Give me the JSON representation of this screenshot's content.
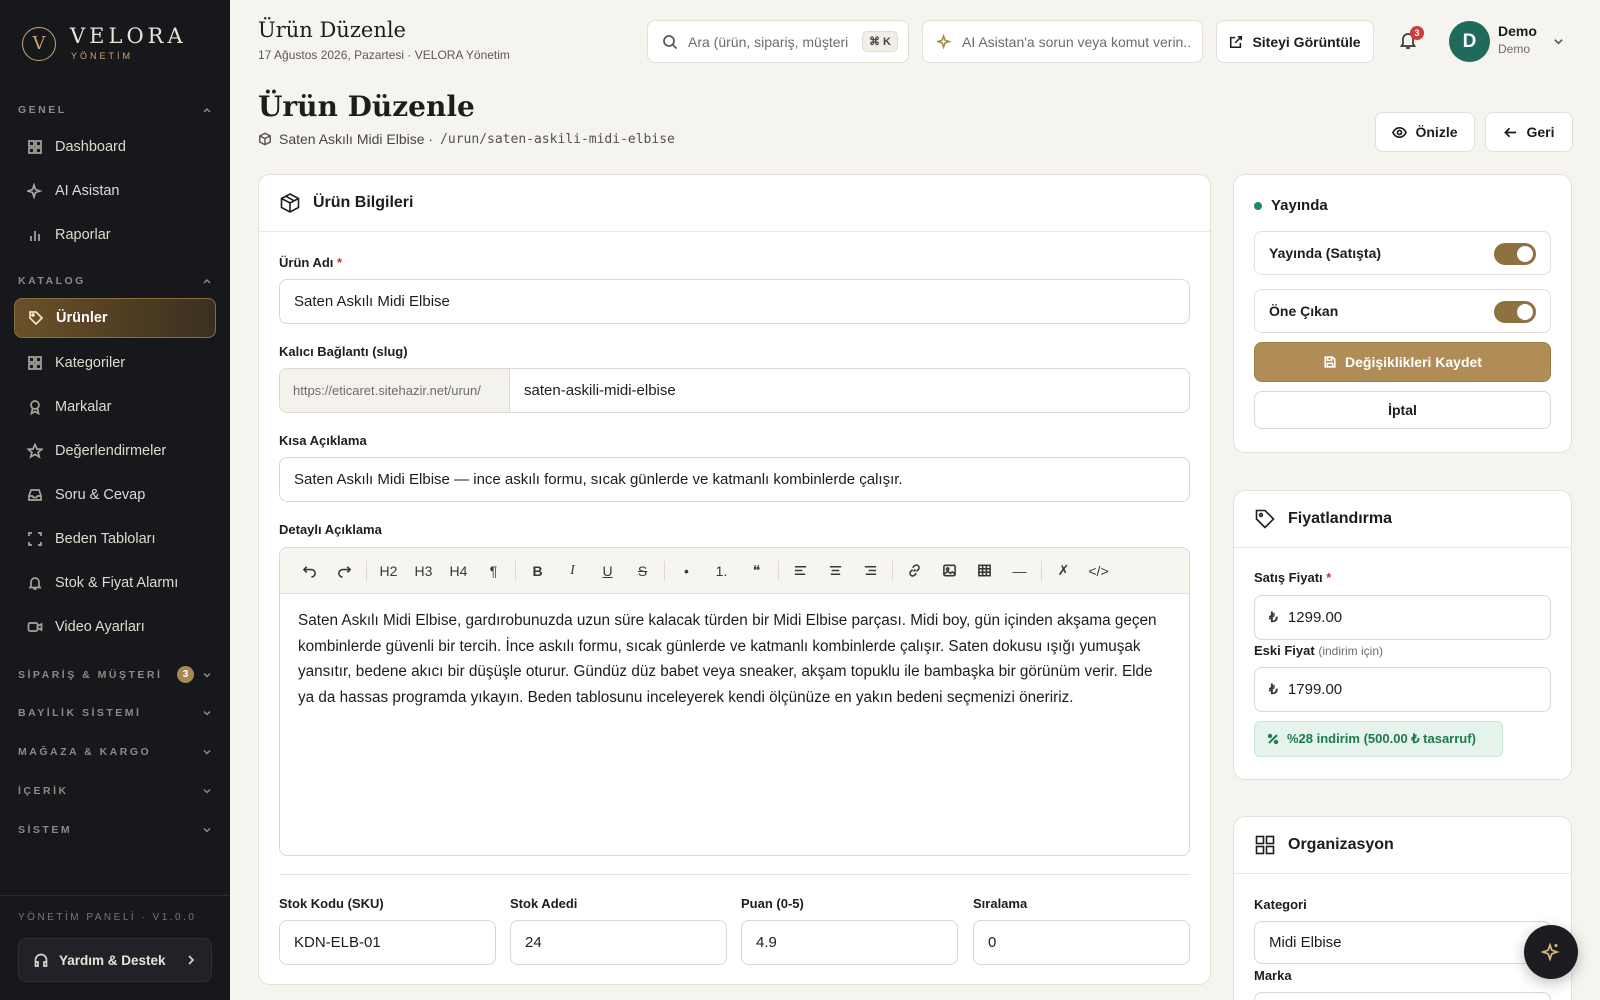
{
  "brand": {
    "mark": "V",
    "name": "VELORA",
    "sub": "YÖNETİM"
  },
  "sidebar": {
    "sections": {
      "general": "GENEL",
      "catalog": "KATALOG",
      "orders": "SİPARİŞ & MÜŞTERİ",
      "orders_badge": "3",
      "dealer": "BAYİLİK SİSTEMİ",
      "store": "MAĞAZA & KARGO",
      "content": "İÇERİK",
      "system": "SİSTEM"
    },
    "general_items": [
      {
        "label": "Dashboard",
        "icon": "grid-icon"
      },
      {
        "label": "AI Asistan",
        "icon": "sparkle-icon"
      },
      {
        "label": "Raporlar",
        "icon": "bar-chart-icon"
      }
    ],
    "catalog_items": [
      {
        "label": "Ürünler",
        "icon": "tag-icon",
        "active": true
      },
      {
        "label": "Kategoriler",
        "icon": "grid-icon"
      },
      {
        "label": "Markalar",
        "icon": "award-icon"
      },
      {
        "label": "Değerlendirmeler",
        "icon": "star-icon"
      },
      {
        "label": "Soru & Cevap",
        "icon": "inbox-icon"
      },
      {
        "label": "Beden Tabloları",
        "icon": "frame-icon"
      },
      {
        "label": "Stok & Fiyat Alarmı",
        "icon": "bell-icon"
      },
      {
        "label": "Video Ayarları",
        "icon": "video-icon"
      }
    ],
    "version": "YÖNETİM PANELİ · V1.0.0",
    "help": "Yardım & Destek"
  },
  "topbar": {
    "title": "Ürün Düzenle",
    "subtitle": "17 Ağustos 2026, Pazartesi · VELORA Yönetim",
    "search_placeholder": "Ara (ürün, sipariş, müşteri...",
    "search_kbd": "⌘ K",
    "ai_placeholder": "AI Asistan'a sorun veya komut verin...",
    "view_site": "Siteyi Görüntüle",
    "notifications": "3",
    "user_initial": "D",
    "user_name": "Demo",
    "user_role": "Demo"
  },
  "header": {
    "title": "Ürün Düzenle",
    "product_name": "Saten Askılı Midi Elbise ·",
    "path": "/urun/saten-askili-midi-elbise",
    "preview": "Önizle",
    "back": "Geri"
  },
  "product": {
    "card_title": "Ürün Bilgileri",
    "name_label": "Ürün Adı",
    "name_value": "Saten Askılı Midi Elbise",
    "slug_label": "Kalıcı Bağlantı (slug)",
    "slug_prefix": "https://eticaret.sitehazir.net/urun/",
    "slug_value": "saten-askili-midi-elbise",
    "short_label": "Kısa Açıklama",
    "short_value": "Saten Askılı Midi Elbise — ince askılı formu, sıcak günlerde ve katmanlı kombinlerde çalışır.",
    "detail_label": "Detaylı Açıklama",
    "toolbar": {
      "h2": "H2",
      "h3": "H3",
      "h4": "H4",
      "para": "¶",
      "bold": "B",
      "italic": "I",
      "underline": "U",
      "strike": "S",
      "bullet": "•",
      "ordered": "1.",
      "quote": "❝",
      "hr": "—",
      "clear": "✗",
      "code": "</>"
    },
    "detail_value": "Saten Askılı Midi Elbise, gardırobunuzda uzun süre kalacak türden bir Midi Elbise parçası. Midi boy, gün içinden akşama geçen kombinlerde güvenli bir tercih. İnce askılı formu, sıcak günlerde ve katmanlı kombinlerde çalışır. Saten dokusu ışığı yumuşak yansıtır, bedene akıcı bir düşüşle oturur. Gündüz düz babet veya sneaker, akşam topuklu ile bambaşka bir görünüm verir. Elde ya da hassas programda yıkayın. Beden tablosunu inceleyerek kendi ölçünüze en yakın bedeni seçmenizi öneririz.",
    "sku_label": "Stok Kodu (SKU)",
    "sku_value": "KDN-ELB-01",
    "stock_label": "Stok Adedi",
    "stock_value": "24",
    "rating_label": "Puan (0-5)",
    "rating_value": "4.9",
    "order_label": "Sıralama",
    "order_value": "0"
  },
  "publish": {
    "title": "Yayında",
    "on_sale": "Yayında (Satışta)",
    "featured": "Öne Çıkan",
    "save": "Değişiklikleri Kaydet",
    "cancel": "İptal"
  },
  "pricing": {
    "title": "Fiyatlandırma",
    "price_label": "Satış Fiyatı",
    "currency": "₺",
    "price_value": "1299.00",
    "old_label": "Eski Fiyat",
    "old_hint": "(indirim için)",
    "old_value": "1799.00",
    "discount": "%28 indirim (500.00 ₺ tasarruf)"
  },
  "organization": {
    "title": "Organizasyon",
    "category_label": "Kategori",
    "category_value": "Midi Elbise",
    "brand_label": "Marka"
  },
  "colors": {
    "accent": "#b08d57",
    "sidebar": "#17181c",
    "success": "#1d7a4f",
    "avatar": "#1f6a5b"
  }
}
